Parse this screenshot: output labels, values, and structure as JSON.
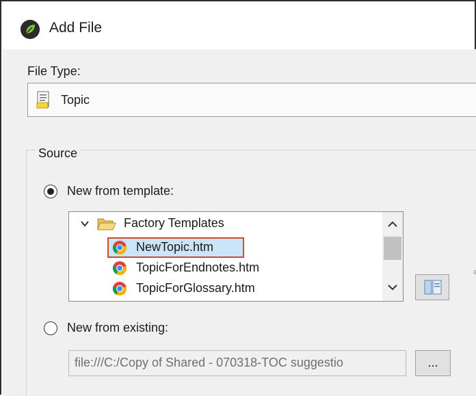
{
  "window": {
    "title": "Add File"
  },
  "file_type": {
    "label": "File Type:",
    "value": "Topic",
    "icon": "topic-document-icon"
  },
  "source": {
    "group_label": "Source",
    "new_from_template": {
      "label": "New from template:",
      "checked": true,
      "tree": {
        "folder": {
          "label": "Factory Templates",
          "expanded": true
        },
        "items": [
          {
            "label": "NewTopic.htm",
            "selected": true
          },
          {
            "label": "TopicForEndnotes.htm",
            "selected": false
          },
          {
            "label": "TopicForGlossary.htm",
            "selected": false
          }
        ]
      }
    },
    "new_from_existing": {
      "label": "New from existing:",
      "checked": false,
      "path_value": "file:///C:/Copy of Shared - 070318-TOC suggestio",
      "browse_label": "..."
    }
  },
  "colors": {
    "selection_outline": "#d24a2a",
    "dialog_bg": "#f0f0f0"
  }
}
